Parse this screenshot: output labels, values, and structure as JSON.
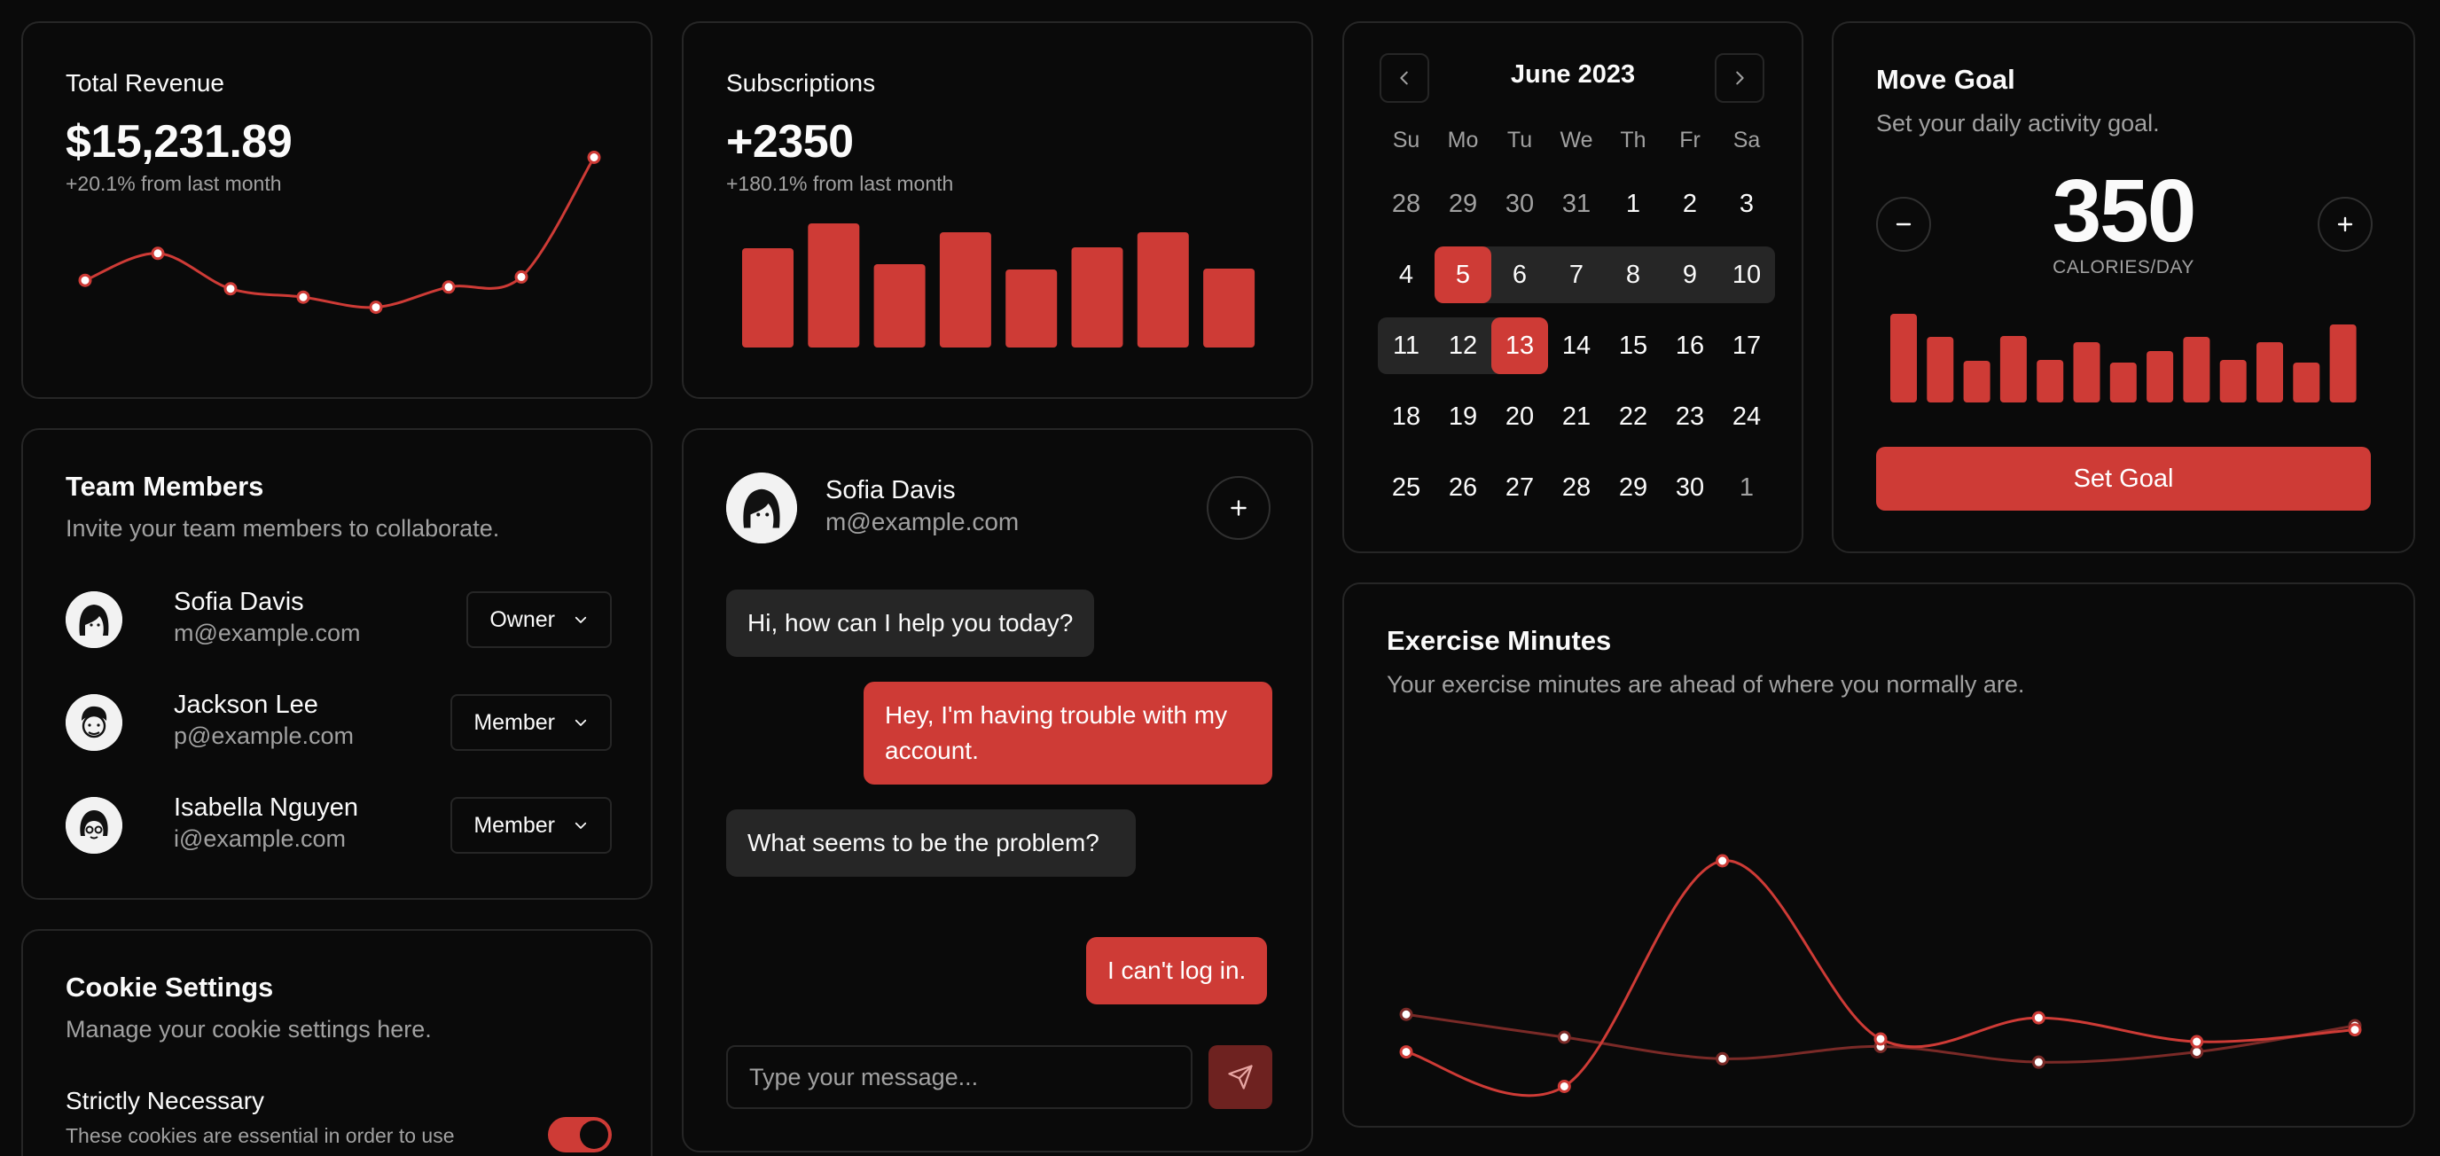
{
  "colors": {
    "accent": "#ce3b36",
    "accent_dim": "#7a2a27",
    "background": "#0a0a0a",
    "border": "#262626",
    "muted": "#a1a1a1"
  },
  "revenue": {
    "label": "Total Revenue",
    "value": "$15,231.89",
    "sub": "+20.1% from last month",
    "chart_data": {
      "type": "line",
      "values": [
        42,
        58,
        37,
        32,
        26,
        38,
        44,
        115
      ]
    }
  },
  "subscriptions": {
    "label": "Subscriptions",
    "value": "+2350",
    "sub": "+180.1% from last month",
    "chart_data": {
      "type": "bar",
      "values": [
        112,
        140,
        94,
        130,
        88,
        113,
        130,
        89
      ]
    }
  },
  "calendar": {
    "title": "June 2023",
    "weekdays": [
      "Su",
      "Mo",
      "Tu",
      "We",
      "Th",
      "Fr",
      "Sa"
    ],
    "weeks": [
      [
        "28",
        "29",
        "30",
        "31",
        "1",
        "2",
        "3"
      ],
      [
        "4",
        "5",
        "6",
        "7",
        "8",
        "9",
        "10"
      ],
      [
        "11",
        "12",
        "13",
        "14",
        "15",
        "16",
        "17"
      ],
      [
        "18",
        "19",
        "20",
        "21",
        "22",
        "23",
        "24"
      ],
      [
        "25",
        "26",
        "27",
        "28",
        "29",
        "30",
        "1"
      ]
    ],
    "selected": [
      "5",
      "13"
    ]
  },
  "goal": {
    "title": "Move Goal",
    "description": "Set your daily activity goal.",
    "value": "350",
    "unit": "CALORIES/DAY",
    "button": "Set Goal",
    "chart_data": {
      "type": "bar",
      "values": [
        100,
        74,
        47,
        75,
        48,
        68,
        45,
        58,
        74,
        48,
        68,
        45,
        88
      ]
    }
  },
  "team": {
    "title": "Team Members",
    "description": "Invite your team members to collaborate.",
    "members": [
      {
        "name": "Sofia Davis",
        "email": "m@example.com",
        "role": "Owner"
      },
      {
        "name": "Jackson Lee",
        "email": "p@example.com",
        "role": "Member"
      },
      {
        "name": "Isabella Nguyen",
        "email": "i@example.com",
        "role": "Member"
      }
    ]
  },
  "cookie": {
    "title": "Cookie Settings",
    "description": "Manage your cookie settings here.",
    "setting_title": "Strictly Necessary",
    "setting_desc": "These cookies are essential in order to use"
  },
  "chat": {
    "user_name": "Sofia Davis",
    "user_email": "m@example.com",
    "messages": [
      {
        "role": "agent",
        "text": "Hi, how can I help you today?"
      },
      {
        "role": "user",
        "text": "Hey, I'm having trouble with my account."
      },
      {
        "role": "agent",
        "text": "What seems to be the problem?"
      },
      {
        "role": "user",
        "text": "I can't log in."
      }
    ],
    "input_placeholder": "Type your message..."
  },
  "exercise": {
    "title": "Exercise Minutes",
    "description": "Your exercise minutes are ahead of where you normally are.",
    "chart_data": {
      "type": "line",
      "series": [
        {
          "values": [
            240,
            139,
            800,
            278,
            340,
            270,
            305
          ]
        },
        {
          "values": [
            350,
            283,
            220,
            256,
            210,
            240,
            317
          ]
        }
      ]
    }
  }
}
